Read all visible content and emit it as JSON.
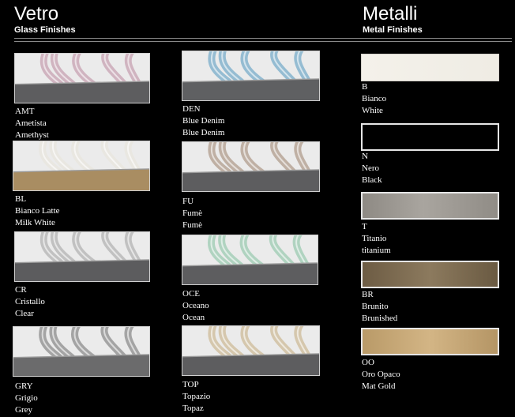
{
  "glass": {
    "title": "Vetro",
    "subtitle": "Glass Finishes",
    "items": [
      {
        "code": "AMT",
        "it": "Ametista",
        "en": "Amethyst",
        "glass_color": "#b9869c",
        "ring_color": "#5d5d5f"
      },
      {
        "code": "DEN",
        "it": "Blue Denim",
        "en": "Blue Denim",
        "glass_color": "#4f95be",
        "ring_color": "#5f6062"
      },
      {
        "code": "BL",
        "it": "Bianco Latte",
        "en": "Milk White",
        "glass_color": "#e8e3d9",
        "ring_color": "#a98d62"
      },
      {
        "code": "FU",
        "it": "Fumè",
        "en": "Fumè",
        "glass_color": "#9a8069",
        "ring_color": "#5d5d5f"
      },
      {
        "code": "CR",
        "it": "Cristallo",
        "en": "Clear",
        "glass_color": "#9e9e9e",
        "ring_color": "#5c5c5e"
      },
      {
        "code": "OCE",
        "it": "Oceano",
        "en": "Ocean",
        "glass_color": "#7fbf9c",
        "ring_color": "#5d5d5f"
      },
      {
        "code": "GRY",
        "it": "Grigio",
        "en": "Grey",
        "glass_color": "#6a6a6a",
        "ring_color": "#6b6b6c"
      },
      {
        "code": "TOP",
        "it": "Topazio",
        "en": "Topaz",
        "glass_color": "#c3a97a",
        "ring_color": "#5d5d5f"
      }
    ]
  },
  "metal": {
    "title": "Metalli",
    "subtitle": "Metal Finishes",
    "items": [
      {
        "code": "B",
        "it": "Bianco",
        "en": "White",
        "color": "#f3f0e9"
      },
      {
        "code": "N",
        "it": "Nero",
        "en": "Black",
        "color": "#000000"
      },
      {
        "code": "T",
        "it": "Titanio",
        "en": "titanium",
        "color": "#a19d97"
      },
      {
        "code": "BR",
        "it": "Brunito",
        "en": "Brunished",
        "color": "#7f6d53"
      },
      {
        "code": "OO",
        "it": "Oro Opaco",
        "en": "Mat Gold",
        "color": "#c9ab7b"
      }
    ]
  }
}
